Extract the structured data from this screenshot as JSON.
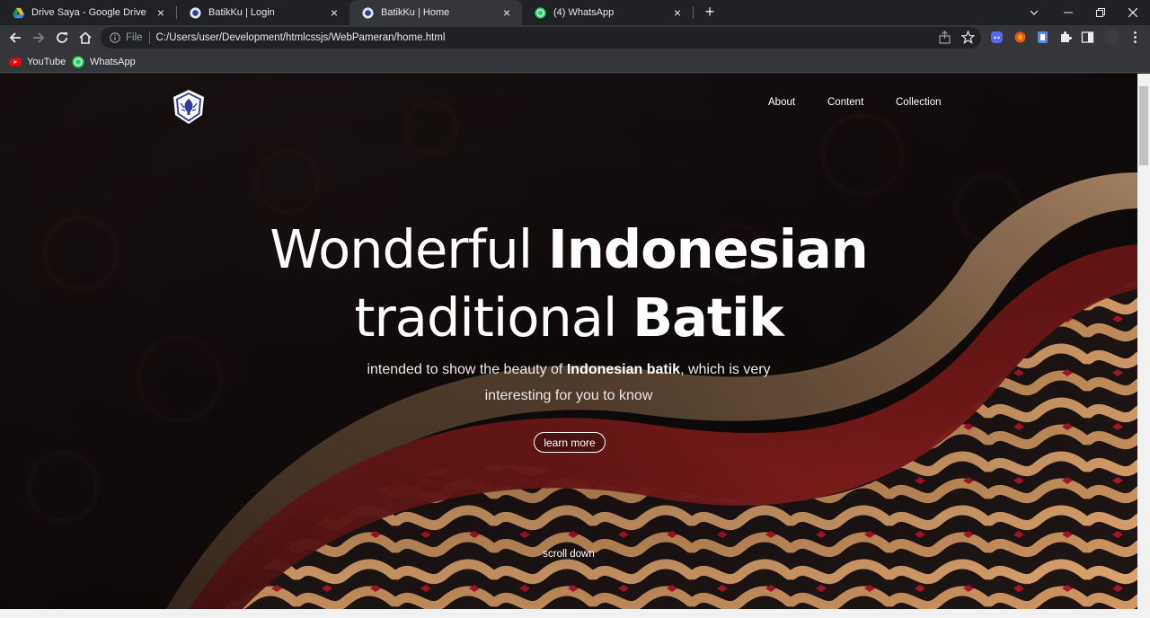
{
  "browser": {
    "tabs": [
      {
        "title": "Drive Saya - Google Drive",
        "icon": "google-drive-icon",
        "active": false
      },
      {
        "title": "BatikKu | Login",
        "icon": "batikku-icon",
        "active": false
      },
      {
        "title": "BatikKu | Home",
        "icon": "batikku-icon",
        "active": true
      },
      {
        "title": "(4) WhatsApp",
        "icon": "whatsapp-icon",
        "active": false
      }
    ],
    "address": {
      "scheme": "File",
      "url": "C:/Users/user/Development/htmlcssjs/WebPameran/home.html"
    },
    "bookmarks": [
      {
        "label": "YouTube",
        "icon": "youtube-icon"
      },
      {
        "label": "WhatsApp",
        "icon": "whatsapp-icon"
      }
    ]
  },
  "page": {
    "nav": {
      "about": "About",
      "content": "Content",
      "collection": "Collection"
    },
    "hero": {
      "title_line1_light": "Wonderful ",
      "title_line1_bold": "Indonesian",
      "title_line2_light": "traditional ",
      "title_line2_bold": "Batik",
      "subtitle_pre": "intended to show the beauty of ",
      "subtitle_bold": "Indonesian batik",
      "subtitle_post": ", which is very",
      "subtitle_line2": "interesting for you to know",
      "button": "learn more",
      "scroll": "scroll down"
    },
    "colors": {
      "background": "#120c0c",
      "batik_gold": "#d9a26b",
      "batik_red": "#8b1e1e",
      "text": "#ffffff"
    }
  }
}
